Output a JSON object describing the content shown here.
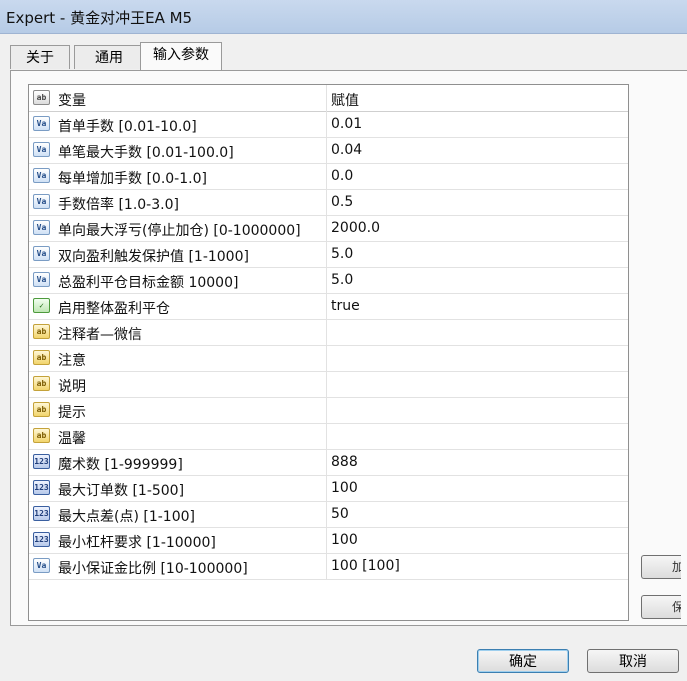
{
  "window": {
    "title": "Expert - 黄金对冲王EA M5"
  },
  "tabs": [
    {
      "label": "关于",
      "active": false
    },
    {
      "label": "通用",
      "active": false
    },
    {
      "label": "输入参数",
      "active": true
    }
  ],
  "grid": {
    "header": {
      "variable": "变量",
      "value": "赋值"
    },
    "rows": [
      {
        "icon": "V",
        "label": "首单手数 [0.01-10.0]",
        "value": "0.01"
      },
      {
        "icon": "V",
        "label": "单笔最大手数 [0.01-100.0]",
        "value": "0.04"
      },
      {
        "icon": "V",
        "label": "每单增加手数 [0.0-1.0]",
        "value": "0.0"
      },
      {
        "icon": "V",
        "label": "手数倍率 [1.0-3.0]",
        "value": "0.5"
      },
      {
        "icon": "V",
        "label": "单向最大浮亏(停止加仓) [0-1000000]",
        "value": "2000.0"
      },
      {
        "icon": "V",
        "label": "双向盈利触发保护值 [1-1000]",
        "value": "5.0"
      },
      {
        "icon": "V",
        "label": "总盈利平仓目标金额 10000]",
        "value": "5.0"
      },
      {
        "icon": "bool",
        "label": "启用整体盈利平仓",
        "value": "true"
      },
      {
        "icon": "ab",
        "label": "注释者—微信",
        "value": ""
      },
      {
        "icon": "ab",
        "label": "注意",
        "value": ""
      },
      {
        "icon": "ab",
        "label": "说明",
        "value": ""
      },
      {
        "icon": "ab",
        "label": "提示",
        "value": ""
      },
      {
        "icon": "ab",
        "label": "温馨",
        "value": ""
      },
      {
        "icon": "123",
        "label": "魔术数 [1-999999]",
        "value": "888"
      },
      {
        "icon": "123",
        "label": "最大订单数 [1-500]",
        "value": "100"
      },
      {
        "icon": "123",
        "label": "最大点差(点) [1-100]",
        "value": "50"
      },
      {
        "icon": "123",
        "label": "最小杠杆要求 [1-10000]",
        "value": "100"
      },
      {
        "icon": "V",
        "label": "最小保证金比例 [10-100000]",
        "value": "100 [100]"
      }
    ]
  },
  "side_buttons": [
    {
      "label": "加载"
    },
    {
      "label": "保存"
    }
  ],
  "buttons": {
    "ok": "确定",
    "cancel": "取消"
  }
}
